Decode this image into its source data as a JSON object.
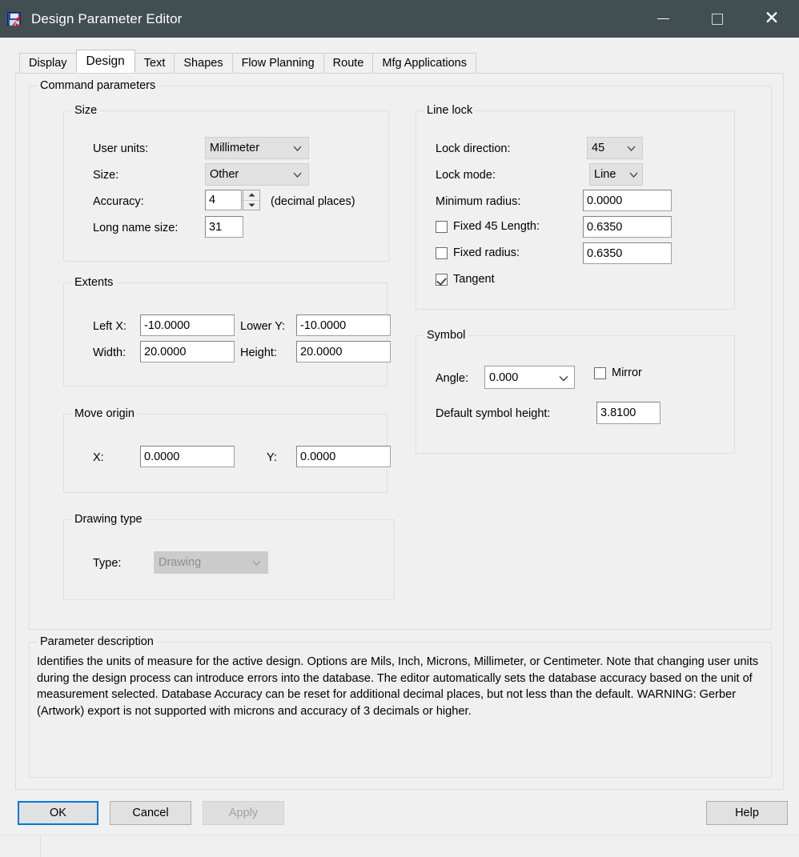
{
  "window": {
    "title": "Design Parameter Editor",
    "icon": "design-parameter-editor-icon",
    "titlebar_color": "#414e52",
    "accent_color": "#0078d7",
    "controls": {
      "minimize": "—",
      "maximize": "□",
      "close": "✕"
    }
  },
  "tabs": [
    {
      "label": "Display",
      "active": false
    },
    {
      "label": "Design",
      "active": true
    },
    {
      "label": "Text",
      "active": false
    },
    {
      "label": "Shapes",
      "active": false
    },
    {
      "label": "Flow Planning",
      "active": false
    },
    {
      "label": "Route",
      "active": false
    },
    {
      "label": "Mfg Applications",
      "active": false
    }
  ],
  "command_parameters": {
    "legend": "Command parameters"
  },
  "size_group": {
    "legend": "Size",
    "user_units_label": "User units:",
    "user_units_value": "Millimeter",
    "size_label": "Size:",
    "size_value": "Other",
    "accuracy_label": "Accuracy:",
    "accuracy_value": "4",
    "accuracy_suffix": "(decimal places)",
    "long_name_label": "Long name size:",
    "long_name_value": "31"
  },
  "extents_group": {
    "legend": "Extents",
    "left_x_label": "Left X:",
    "left_x_value": "-10.0000",
    "lower_y_label": "Lower Y:",
    "lower_y_value": "-10.0000",
    "width_label": "Width:",
    "width_value": "20.0000",
    "height_label": "Height:",
    "height_value": "20.0000"
  },
  "move_origin_group": {
    "legend": "Move origin",
    "x_label": "X:",
    "x_value": "0.0000",
    "y_label": "Y:",
    "y_value": "0.0000"
  },
  "drawing_type_group": {
    "legend": "Drawing type",
    "type_label": "Type:",
    "type_value": "Drawing"
  },
  "line_lock_group": {
    "legend": "Line lock",
    "lock_direction_label": "Lock direction:",
    "lock_direction_value": "45",
    "lock_mode_label": "Lock mode:",
    "lock_mode_value": "Line",
    "minimum_radius_label": "Minimum radius:",
    "minimum_radius_value": "0.0000",
    "fixed_45_label": "Fixed 45 Length:",
    "fixed_45_value": "0.6350",
    "fixed_45_checked": false,
    "fixed_radius_label": "Fixed radius:",
    "fixed_radius_value": "0.6350",
    "fixed_radius_checked": false,
    "tangent_label": "Tangent",
    "tangent_checked": true
  },
  "symbol_group": {
    "legend": "Symbol",
    "angle_label": "Angle:",
    "angle_value": "0.000",
    "mirror_label": "Mirror",
    "mirror_checked": false,
    "default_symbol_height_label": "Default symbol height:",
    "default_symbol_height_value": "3.8100"
  },
  "description": {
    "legend": "Parameter description",
    "text": "Identifies the units of measure for the active design. Options are Mils, Inch, Microns, Millimeter, or Centimeter. Note that changing user units during the design process can introduce errors into the database.  The editor automatically sets the database accuracy based on the unit of measurement selected. Database Accuracy can be reset for additional decimal places, but not less than the default. WARNING: Gerber (Artwork) export is not supported with microns and accuracy of 3 decimals or higher."
  },
  "buttons": {
    "ok": "OK",
    "cancel": "Cancel",
    "apply": "Apply",
    "apply_enabled": false,
    "help": "Help"
  }
}
